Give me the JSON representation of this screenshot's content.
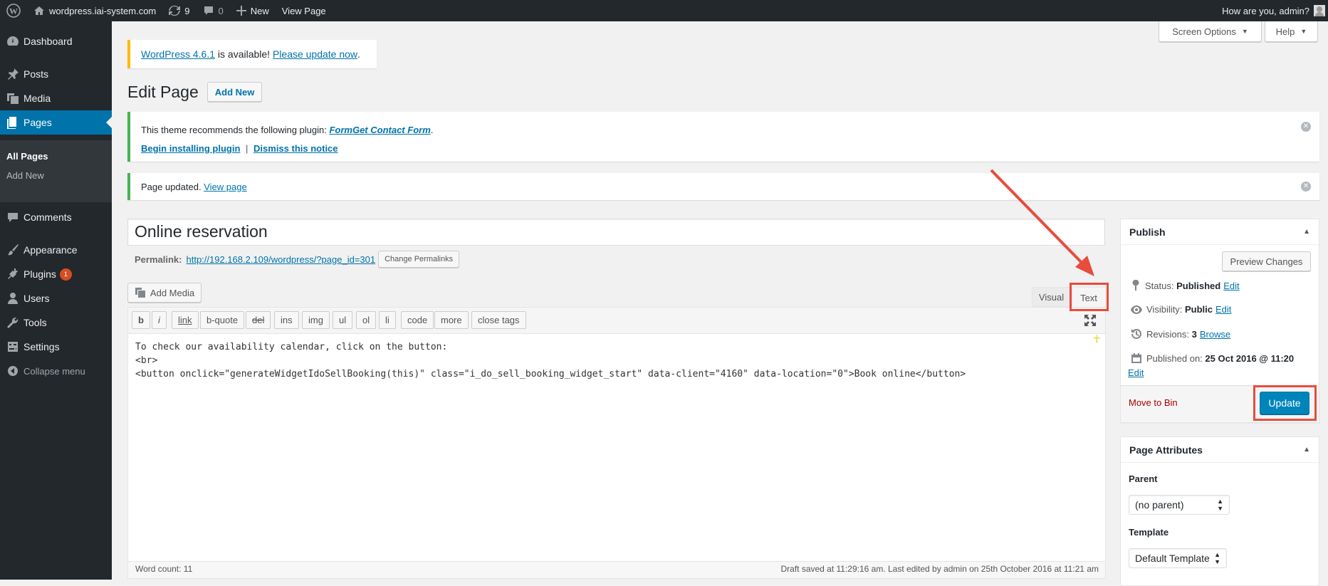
{
  "adminbar": {
    "site_name": "wordpress.iai-system.com",
    "updates_count": "9",
    "comments_count": "0",
    "new_label": "New",
    "view_page_label": "View Page",
    "greeting": "How are you, admin?"
  },
  "sidebar": {
    "dashboard": "Dashboard",
    "posts": "Posts",
    "media": "Media",
    "pages": "Pages",
    "all_pages": "All Pages",
    "add_new": "Add New",
    "comments": "Comments",
    "appearance": "Appearance",
    "plugins": "Plugins",
    "plugins_badge": "1",
    "users": "Users",
    "tools": "Tools",
    "settings": "Settings",
    "collapse": "Collapse menu"
  },
  "screen_meta": {
    "screen_options": "Screen Options",
    "help": "Help"
  },
  "update_nag": {
    "version_link": "WordPress 4.6.1",
    "middle": " is available! ",
    "update_link": "Please update now",
    "end": "."
  },
  "heading": {
    "title": "Edit Page",
    "add_new": "Add New"
  },
  "plugin_notice": {
    "text": "This theme recommends the following plugin: ",
    "plugin_link": "FormGet Contact Form",
    "period": ".",
    "begin_link": "Begin installing plugin",
    "separator": "|",
    "dismiss_link": "Dismiss this notice"
  },
  "updated_notice": {
    "text": "Page updated. ",
    "view_link": "View page"
  },
  "editor": {
    "title": "Online reservation",
    "permalink_label": "Permalink:",
    "permalink_url": "http://192.168.2.109/wordpress/?page_id=301",
    "change_permalinks": "Change Permalinks",
    "add_media": "Add Media",
    "tab_visual": "Visual",
    "tab_text": "Text",
    "quicktags": [
      "b",
      "i",
      "link",
      "b-quote",
      "del",
      "ins",
      "img",
      "ul",
      "ol",
      "li",
      "code",
      "more",
      "close tags"
    ],
    "content_line1": "To check our availability calendar, click on the button:",
    "content_line2": "<br>",
    "content_line3": "<button onclick=\"generateWidgetIdoSellBooking(this)\" class=\"i_do_sell_booking_widget_start\" data-client=\"4160\" data-location=\"0\">Book online</button>",
    "word_count": "Word count: 11",
    "draft_status": "Draft saved at 11:29:16 am. Last edited by admin on 25th October 2016 at 11:21 am"
  },
  "publish": {
    "title": "Publish",
    "preview": "Preview Changes",
    "status_label": "Status: ",
    "status_value": "Published",
    "visibility_label": "Visibility: ",
    "visibility_value": "Public",
    "revisions_label": "Revisions: ",
    "revisions_value": "3",
    "browse": "Browse",
    "published_label": "Published on: ",
    "published_value": "25 Oct 2016 @ 11:20",
    "edit": "Edit",
    "move_to_bin": "Move to Bin",
    "update": "Update"
  },
  "page_attributes": {
    "title": "Page Attributes",
    "parent_label": "Parent",
    "parent_value": "(no parent)",
    "template_label": "Template",
    "template_value": "Default Template"
  },
  "colors": {
    "accent": "#0073aa",
    "sidebar": "#23282d",
    "highlight_red": "#e74c3c",
    "update_button": "#0085ba"
  }
}
